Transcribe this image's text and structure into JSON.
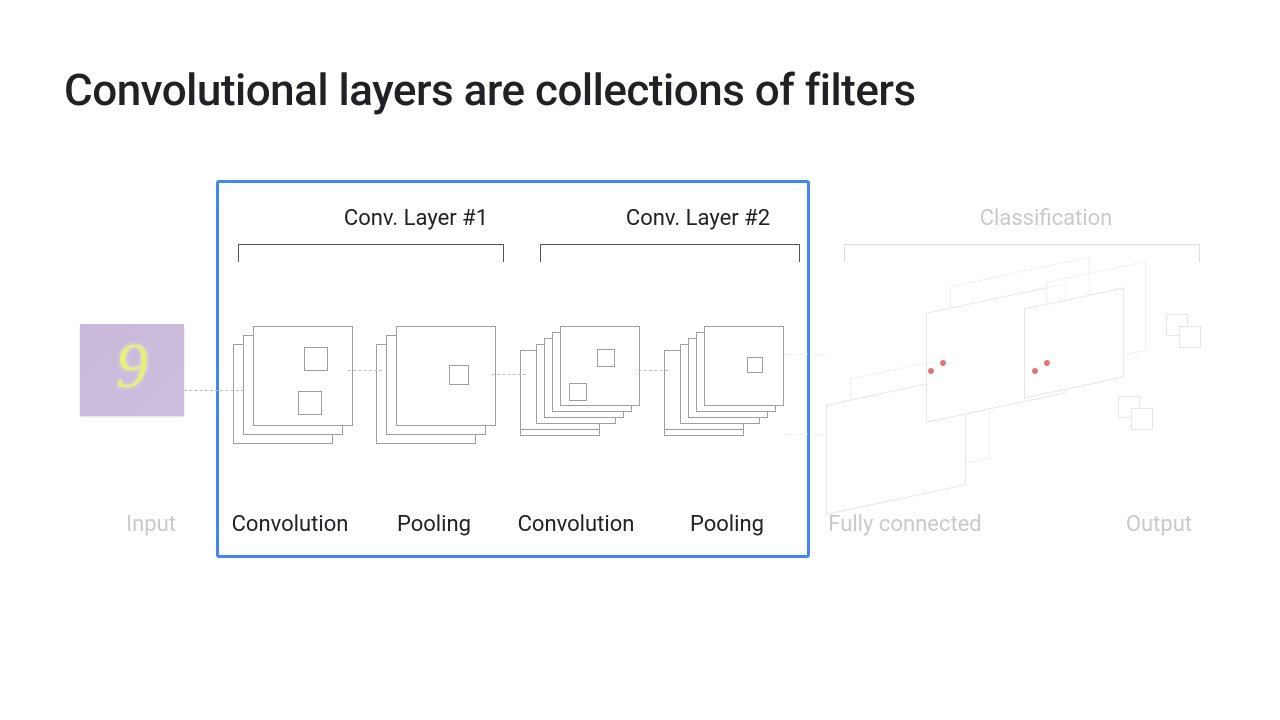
{
  "title": "Convolutional layers are collections of filters",
  "headers": {
    "conv1": "Conv. Layer #1",
    "conv2": "Conv. Layer #2",
    "classification": "Classification"
  },
  "labels": {
    "input": "Input",
    "convolution1": "Convolution",
    "pooling1": "Pooling",
    "convolution2": "Convolution",
    "pooling2": "Pooling",
    "fully_connected": "Fully connected",
    "output": "Output"
  },
  "input_digit": "9",
  "colors": {
    "highlight": "#4285F4",
    "faded_text": "#c9c9c9"
  }
}
